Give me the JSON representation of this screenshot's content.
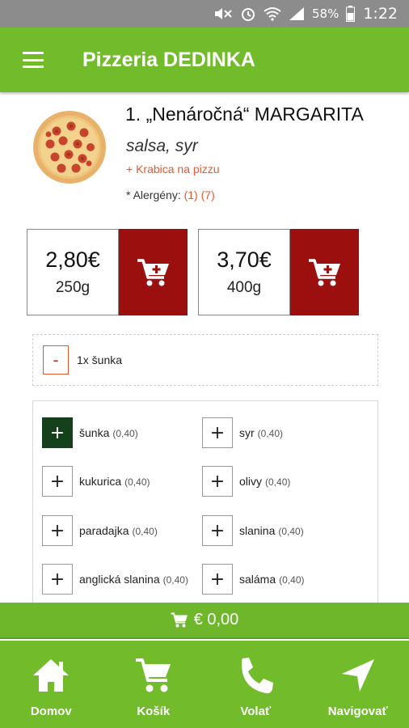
{
  "status_bar": {
    "battery_percent": "58%",
    "time": "1:22"
  },
  "app_bar": {
    "title": "Pizzeria DEDINKA"
  },
  "product": {
    "title": "1. „Nenáročná“ MARGARITA",
    "description": "salsa, syr",
    "box_link": "+ Krabica na pizzu",
    "allergens_label": "* Alergény:",
    "allergens": [
      "(1)",
      "(7)"
    ]
  },
  "sizes": [
    {
      "price": "2,80€",
      "weight": "250g"
    },
    {
      "price": "3,70€",
      "weight": "400g"
    }
  ],
  "selected_extras": [
    {
      "label": "1x šunka",
      "remove_label": "-"
    }
  ],
  "extras": [
    {
      "name": "šunka",
      "price": "(0,40)",
      "selected": true
    },
    {
      "name": "syr",
      "price": "(0,40)",
      "selected": false
    },
    {
      "name": "kukurica",
      "price": "(0,40)",
      "selected": false
    },
    {
      "name": "olivy",
      "price": "(0,40)",
      "selected": false
    },
    {
      "name": "paradajka",
      "price": "(0,40)",
      "selected": false
    },
    {
      "name": "slanina",
      "price": "(0,40)",
      "selected": false
    },
    {
      "name": "anglická slanina",
      "price": "(0,40)",
      "selected": false
    },
    {
      "name": "saláma",
      "price": "(0,40)",
      "selected": false
    }
  ],
  "add_symbol": "+",
  "cart": {
    "total": "€ 0,00"
  },
  "bottom_nav": [
    {
      "label": "Domov",
      "icon": "home-icon"
    },
    {
      "label": "Košík",
      "icon": "cart-icon"
    },
    {
      "label": "Volať",
      "icon": "phone-icon"
    },
    {
      "label": "Navigovať",
      "icon": "navigation-icon"
    }
  ],
  "colors": {
    "brand_green": "#72bc2c",
    "status_bar": "#8c8c8c",
    "add_to_cart_red": "#9b0f0f",
    "link_orange": "#e8582a",
    "selected_dark_green": "#14401c"
  }
}
